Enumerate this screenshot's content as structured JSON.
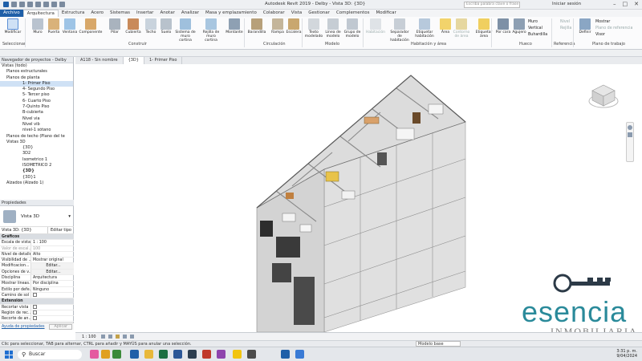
{
  "app": {
    "title": "Autodesk Revit 2019 - Delby - Vista 3D: {3D}",
    "search_placeholder": "Escriba palabra clave o frase",
    "login": "Iniciar sesión"
  },
  "tabs": [
    "Archivo",
    "Arquitectura",
    "Estructura",
    "Acero",
    "Sistemas",
    "Insertar",
    "Anotar",
    "Analizar",
    "Masa y emplazamiento",
    "Colaborar",
    "Vista",
    "Gestionar",
    "Complementos",
    "Modificar"
  ],
  "ribbon": {
    "buttons": [
      "Modificar",
      "Muro",
      "Puerta",
      "Ventana",
      "Componente",
      "Pilar",
      "Cubierta",
      "Techo",
      "Suelo",
      "Sistema de muro cortina",
      "Rejilla de muro cortina",
      "Montante",
      "Barandilla",
      "Rampa",
      "Escalera",
      "Texto modelado",
      "Línea de modelo",
      "Grupo de modelo",
      "Habitación",
      "Separador de habitación",
      "Etiquetar habitación",
      "Área",
      "Contorno de área",
      "Etiquetar área",
      "Por cara",
      "Agujero",
      "Muro",
      "Vertical",
      "Buhardilla",
      "Nivel",
      "Rejilla",
      "Definir",
      "Mostrar",
      "Plano de referencia",
      "Visor"
    ],
    "panels": [
      "Seleccionar",
      "Construir",
      "Circulación",
      "Modelo",
      "Habitación y área",
      "Hueco",
      "Referencia",
      "Plano de trabajo"
    ]
  },
  "project_browser": {
    "title": "Navegador de proyectos - Delby",
    "items": [
      "Vistas (todo)",
      "Planos estructurales",
      "Planos de planta",
      "1- Primer Piso",
      "4- Segundo Piso",
      "5- Tercer piso",
      "6- Cuarto Piso",
      "7-Quinto Piso",
      "B-cubierta",
      "Nivel via",
      "Nivel vib",
      "nivel-1 sótano",
      "Planos de techo (Plano del te",
      "Vistas 3D",
      "{3D}",
      "3D2",
      "Isometrico 1",
      "ISOMETRICO 2",
      "{3D}",
      "{3D}1",
      "Alzados (Alzado 1)"
    ]
  },
  "properties": {
    "title": "Propiedades",
    "type": "Vista 3D",
    "selector": "Vista 3D: {3D}",
    "edit_type": "Editar tipo",
    "group1": "Gráficos",
    "rows": [
      {
        "k": "Escala de vista",
        "v": "1 : 100"
      },
      {
        "k": "Valor de escal...",
        "v": "100"
      },
      {
        "k": "Nivel de detalle",
        "v": "Alto"
      },
      {
        "k": "Visibilidad de ...",
        "v": "Mostrar original"
      },
      {
        "k": "Modificacion...",
        "v": "Editar..."
      },
      {
        "k": "Opciones de v...",
        "v": "Editar..."
      },
      {
        "k": "Disciplina",
        "v": "Arquitectura"
      },
      {
        "k": "Mostrar líneas...",
        "v": "Por disciplina"
      },
      {
        "k": "Estilo por defe...",
        "v": "Ninguno"
      },
      {
        "k": "Camino de sol",
        "v": ""
      }
    ],
    "group2": "Extensión",
    "rows2": [
      {
        "k": "Recortar vista",
        "v": ""
      },
      {
        "k": "Región de rec...",
        "v": ""
      },
      {
        "k": "Recorte de an...",
        "v": ""
      }
    ],
    "help": "Ayuda de propiedades",
    "apply": "Aplicar"
  },
  "view_tabs": [
    "A118 - Sin nombre",
    "{3D}",
    "1- Primer Piso"
  ],
  "view_scale": "1 : 100",
  "status_text": "Clic para seleccionar, TAB para alternar, CTRL para añadir y MAYÚS para anular una selección.",
  "model_field": "Modelo base",
  "taskbar": {
    "search": "Buscar",
    "time": "3:31 p. m.",
    "date": "9/04/2024"
  },
  "watermark": {
    "brand": "esencia",
    "sub": "INMOBILIARIA"
  },
  "colors": {
    "accent": "#1f5fa8",
    "brand": "#2a8a9a"
  }
}
